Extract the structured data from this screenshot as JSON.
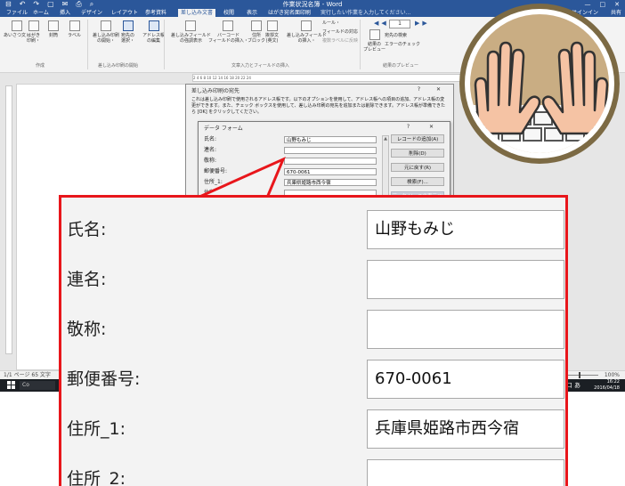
{
  "window": {
    "title": "作業状況名簿 - Word",
    "controls": [
      "—",
      "□",
      "✕"
    ],
    "quick_access": [
      "⊟",
      "↶",
      "↷",
      "▢",
      "✉",
      "⎙",
      "⌕"
    ]
  },
  "ribbon": {
    "tabs": [
      "ファイル",
      "ホーム",
      "挿入",
      "デザイン",
      "レイアウト",
      "参考資料",
      "差し込み文書",
      "校閲",
      "表示",
      "はがき宛名面印刷"
    ],
    "active_tab": "差し込み文書",
    "tell_me": "実行したい作業を入力してください...",
    "sign_in": "サインイン",
    "share": "共有",
    "buttons": [
      {
        "label": "あいさつ文・",
        "sub": ""
      },
      {
        "label": "はがき",
        "sub": "印刷・"
      },
      {
        "label": "封筒",
        "sub": ""
      },
      {
        "label": "ラベル",
        "sub": ""
      },
      {
        "label": "差し込み印刷",
        "sub": "の開始・"
      },
      {
        "label": "宛先の",
        "sub": "選択・"
      },
      {
        "label": "アドレス帳",
        "sub": "の編集"
      },
      {
        "label": "差し込みフィールド",
        "sub": "の強調表示"
      },
      {
        "label": "バーコード",
        "sub": "フィールドの挿入・"
      },
      {
        "label": "住所",
        "sub": "ブロック"
      },
      {
        "label": "挨拶文",
        "sub": "(英文)"
      },
      {
        "label": "差し込みフィールド",
        "sub": "の挿入・"
      },
      {
        "label": "結果の",
        "sub": "プレビュー"
      }
    ],
    "small_buttons": [
      "ルール・",
      "フィールドの対応",
      "複数ラベルに反映",
      "宛先の検索",
      "エラーのチェック"
    ],
    "record_number": "1",
    "group_labels": [
      "作成",
      "差し込み印刷の開始",
      "文章入力とフィールドの挿入",
      "結果のプレビュー"
    ]
  },
  "ruler": {
    "marks": "2   4   6   8   10   12   14   16   18   20   22   24"
  },
  "mail_merge_dialog": {
    "title": "差し込み印刷の宛先",
    "controls": "? ✕",
    "description": "これは差し込み印刷で使用されるアドレス帳です。以下のオプションを使用して、アドレス帳への項目の追加、アドレス帳の変更ができます。また、チェック ボックスを使用して、差し込み印刷の宛先を追加または削除できます。アドレス帳が準備できたら [OK] をクリックしてください。"
  },
  "data_form": {
    "title": "データ フォーム",
    "controls": "? ✕",
    "fields": [
      {
        "label": "氏名:",
        "value": "山野もみじ"
      },
      {
        "label": "連名:",
        "value": ""
      },
      {
        "label": "敬称:",
        "value": ""
      },
      {
        "label": "郵便番号:",
        "value": "670-0061"
      },
      {
        "label": "住所_1:",
        "value": "兵庫県姫路市西今宿"
      },
      {
        "label": "住所_2:",
        "value": ""
      }
    ],
    "buttons": [
      "レコードの追加(A)",
      "削除(D)",
      "元に戻す(R)",
      "検索(F)...",
      "データ ソースの表示(S)"
    ]
  },
  "status": {
    "page": "1/1 ページ",
    "words": "65 文字",
    "zoom": "100%"
  },
  "taskbar": {
    "search": "Co",
    "ime": "口 あ",
    "time": "16:22",
    "date": "2016/04/18"
  },
  "callout": {
    "fields": [
      {
        "label": "氏名:",
        "value": "山野もみじ"
      },
      {
        "label": "連名:",
        "value": ""
      },
      {
        "label": "敬称:",
        "value": ""
      },
      {
        "label": "郵便番号:",
        "value": "670-0061"
      },
      {
        "label": "住所_1:",
        "value": "兵庫県姫路市西今宿"
      },
      {
        "label": "住所_2:",
        "value": ""
      }
    ]
  },
  "colors": {
    "word_blue": "#2b579a",
    "callout_border": "#e8161b",
    "badge_ring": "#7c6a44",
    "badge_fill": "#c9ad83",
    "skin": "#f5c3a4"
  }
}
